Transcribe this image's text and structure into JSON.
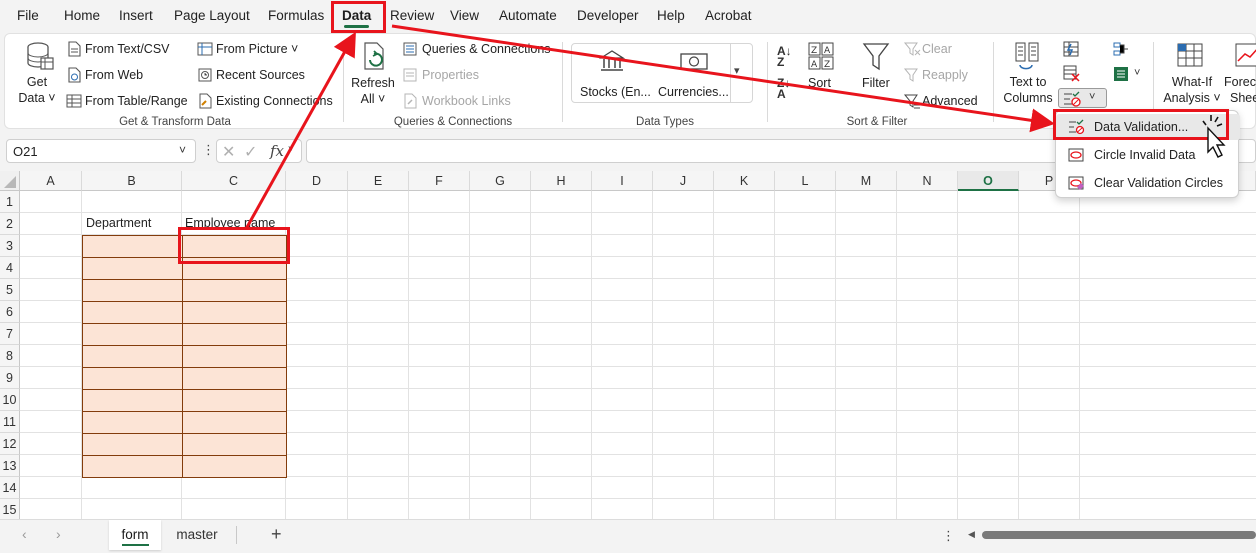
{
  "menu": {
    "tabs": [
      "File",
      "Home",
      "Insert",
      "Page Layout",
      "Formulas",
      "Data",
      "Review",
      "View",
      "Automate",
      "Developer",
      "Help",
      "Acrobat"
    ],
    "active": "Data"
  },
  "ribbon": {
    "get_transform": {
      "get_data_1": "Get",
      "get_data_2": "Data",
      "from_text_csv": "From Text/CSV",
      "from_web": "From Web",
      "from_table_range": "From Table/Range",
      "from_picture": "From Picture",
      "recent_sources": "Recent Sources",
      "existing_connections": "Existing Connections",
      "label": "Get & Transform Data"
    },
    "queries": {
      "refresh_1": "Refresh",
      "refresh_2": "All",
      "queries_connections": "Queries & Connections",
      "properties": "Properties",
      "workbook_links": "Workbook Links",
      "label": "Queries & Connections"
    },
    "data_types": {
      "stocks": "Stocks (En...",
      "currencies": "Currencies...",
      "label": "Data Types"
    },
    "sort_filter": {
      "sort": "Sort",
      "filter": "Filter",
      "clear": "Clear",
      "reapply": "Reapply",
      "advanced": "Advanced",
      "label": "Sort & Filter"
    },
    "data_tools": {
      "text_to_1": "Text to",
      "text_to_2": "Columns"
    },
    "forecast": {
      "what_if_1": "What-If",
      "what_if_2": "Analysis",
      "forecast_1": "Foreca",
      "forecast_2": "Shee"
    }
  },
  "formula_bar": {
    "name_box": "O21",
    "fx": "fx",
    "value": ""
  },
  "grid": {
    "columns": [
      "A",
      "B",
      "C",
      "D",
      "E",
      "F",
      "G",
      "H",
      "I",
      "J",
      "K",
      "L",
      "M",
      "N",
      "O",
      "P"
    ],
    "selected_column": "O",
    "rows": [
      "1",
      "2",
      "3",
      "4",
      "5",
      "6",
      "7",
      "8",
      "9",
      "10",
      "11",
      "12",
      "13",
      "14",
      "15"
    ],
    "b2": "Department",
    "c2": "Employee name"
  },
  "sheets": {
    "tabs": [
      "form",
      "master"
    ],
    "active": "form",
    "add": "+"
  },
  "dropdown": {
    "items": [
      "Data Validation...",
      "Circle Invalid Data",
      "Clear Validation Circles"
    ]
  },
  "colors": {
    "accent": "#1e7145",
    "table_fill": "#fce4d6",
    "table_border": "#833c0c",
    "annotation": "#e8141c"
  }
}
